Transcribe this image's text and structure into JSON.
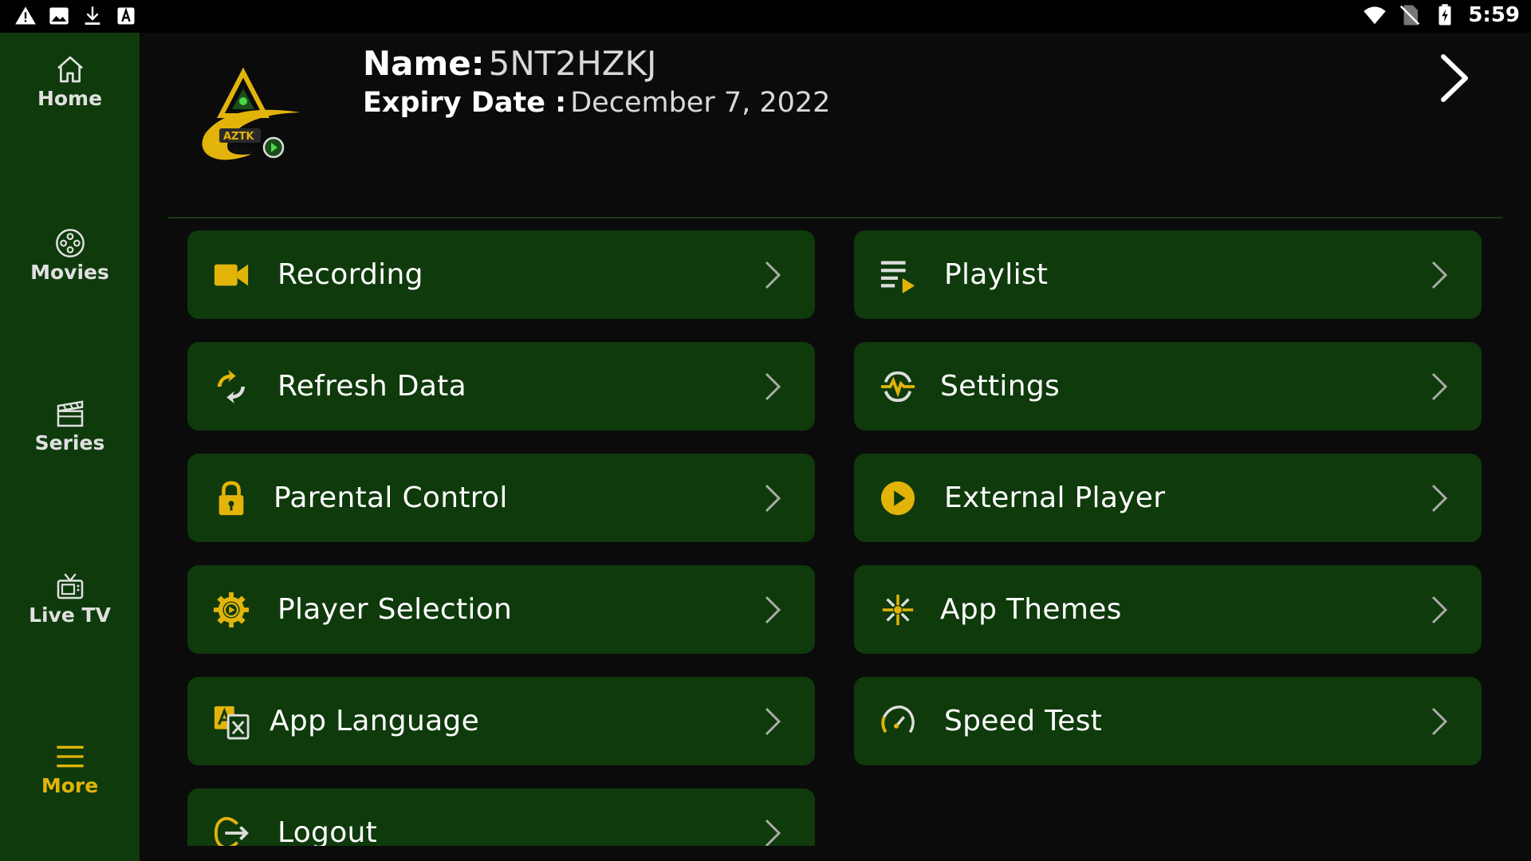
{
  "status_bar": {
    "time": "5:59",
    "left_icons": [
      "warning-icon",
      "image-icon",
      "download-icon",
      "a-box-icon"
    ],
    "right_icons": [
      "wifi-icon",
      "no-sim-icon",
      "battery-charging-icon"
    ]
  },
  "sidebar": {
    "items": [
      {
        "label": "Home",
        "icon": "home-icon"
      },
      {
        "label": "Movies",
        "icon": "film-reel-icon"
      },
      {
        "label": "Series",
        "icon": "clapperboard-icon"
      },
      {
        "label": "Live TV",
        "icon": "tv-icon"
      },
      {
        "label": "More",
        "icon": "menu-icon",
        "active": true
      }
    ]
  },
  "header": {
    "logo_text": "AZTK Play",
    "name_label": "Name:",
    "name_value": "5NT2HZKJ",
    "expiry_label": "Expiry Date :",
    "expiry_value": "December 7, 2022"
  },
  "menu": {
    "left": [
      {
        "label": "Recording",
        "icon": "video-camera-icon"
      },
      {
        "label": "Refresh Data",
        "icon": "refresh-icon"
      },
      {
        "label": "Parental Control",
        "icon": "lock-icon"
      },
      {
        "label": "Player Selection",
        "icon": "gear-play-icon"
      },
      {
        "label": "App Language",
        "icon": "translate-icon"
      },
      {
        "label": "Logout",
        "icon": "logout-icon"
      }
    ],
    "right": [
      {
        "label": "Playlist",
        "icon": "playlist-icon"
      },
      {
        "label": "Settings",
        "icon": "settings-pulse-icon"
      },
      {
        "label": "External Player",
        "icon": "play-circle-icon"
      },
      {
        "label": "App Themes",
        "icon": "sparkle-icon"
      },
      {
        "label": "Speed Test",
        "icon": "speedometer-icon"
      }
    ]
  },
  "colors": {
    "accent": "#e2b40a",
    "card_bg": "#0f3a0c",
    "sidebar_bg": "#0f3a0c",
    "background": "#0b0b0b"
  }
}
